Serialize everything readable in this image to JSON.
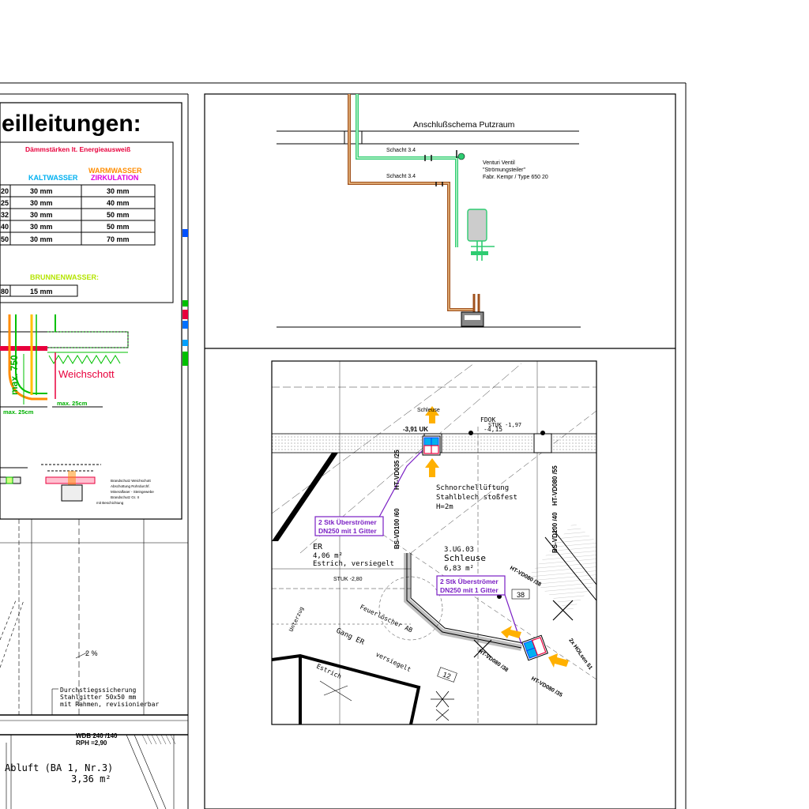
{
  "legend": {
    "title": "eilleitungen:",
    "insulation_header": "Dämmstärken lt. Energieausweiß",
    "columns": {
      "kaltwasser": "KALTWASSER",
      "warmwasser": "WARMWASSER",
      "zirkulation": "ZIRKULATION"
    },
    "rows": [
      {
        "dn": "20",
        "kalt": "30 mm",
        "warm": "30 mm"
      },
      {
        "dn": "25",
        "kalt": "30 mm",
        "warm": "40 mm"
      },
      {
        "dn": "32",
        "kalt": "30 mm",
        "warm": "50 mm"
      },
      {
        "dn": "40",
        "kalt": "30 mm",
        "warm": "50 mm"
      },
      {
        "dn": "50",
        "kalt": "30 mm",
        "warm": "70 mm"
      }
    ],
    "brunnen_label": "BRUNNENWASSER:",
    "brunnen_row": {
      "dn": "80",
      "value": "15 mm"
    },
    "weichschott": "Weichschott",
    "max750": "max. 750",
    "max25a": "max. 25cm",
    "max25b": "max. 25cm"
  },
  "left_plan": {
    "slope": "2 %",
    "grid_note": [
      "Durchstiegssicherung",
      "Stahlgitter 50x50 mm",
      "mit Rahmen, revisionierbar"
    ],
    "wdb": "WDB 240 /140",
    "rph": "RPH =2,90",
    "room": "Abluft (BA 1, Nr.3)",
    "area": "3,36 m²"
  },
  "schema": {
    "title": "Anschlußschema Putzraum",
    "schacht1": "Schacht 3.4",
    "schacht2": "Schacht 3.4",
    "venturi": [
      "Venturi Ventil",
      "\"Strömungsteiler\"",
      "Fabr. Kempr / Type 650 20"
    ]
  },
  "detail": {
    "callout1": [
      "2 Stk Überströmer",
      "DN250 mit 1 Gitter"
    ],
    "callout2": [
      "2 Stk Überströmer",
      "DN250 mit 1 Gitter"
    ],
    "room_er": "ER",
    "room_er_area": "4,06 m²",
    "room_er_floor": "Estrich, versiegelt",
    "room_schleuse_id": "3.UG.03",
    "room_schleuse": "Schleuse",
    "room_schleuse_area": "6,83 m²",
    "schnorchel": [
      "Schnorchellüftung",
      "Stahlblech stoßfest",
      "H=2m"
    ],
    "gang": "Gang ER",
    "feuer": "Feuerlöscher AB",
    "stuk1": "STUK -2,80",
    "uk": "-3,91 UK",
    "fdok": "FDOK",
    "stuk2": "STUK -1,97",
    "stuk3": "-4,15",
    "schleuse_top": "Schleuse",
    "tag38": "38",
    "tag12": "12",
    "unterzug": "Unterzug",
    "estrich": "Estrich",
    "versiegelt": "versiegelt"
  },
  "colors": {
    "kalt": "#00b0f0",
    "warm": "#ff8c00",
    "zirk": "#e000e0",
    "brunnen": "#b4e400",
    "red": "#e8003c",
    "pipe_brown": "#a0521e",
    "pipe_green": "#2ecc71",
    "purple": "#7a1fc4",
    "arrow": "#ffb000"
  }
}
